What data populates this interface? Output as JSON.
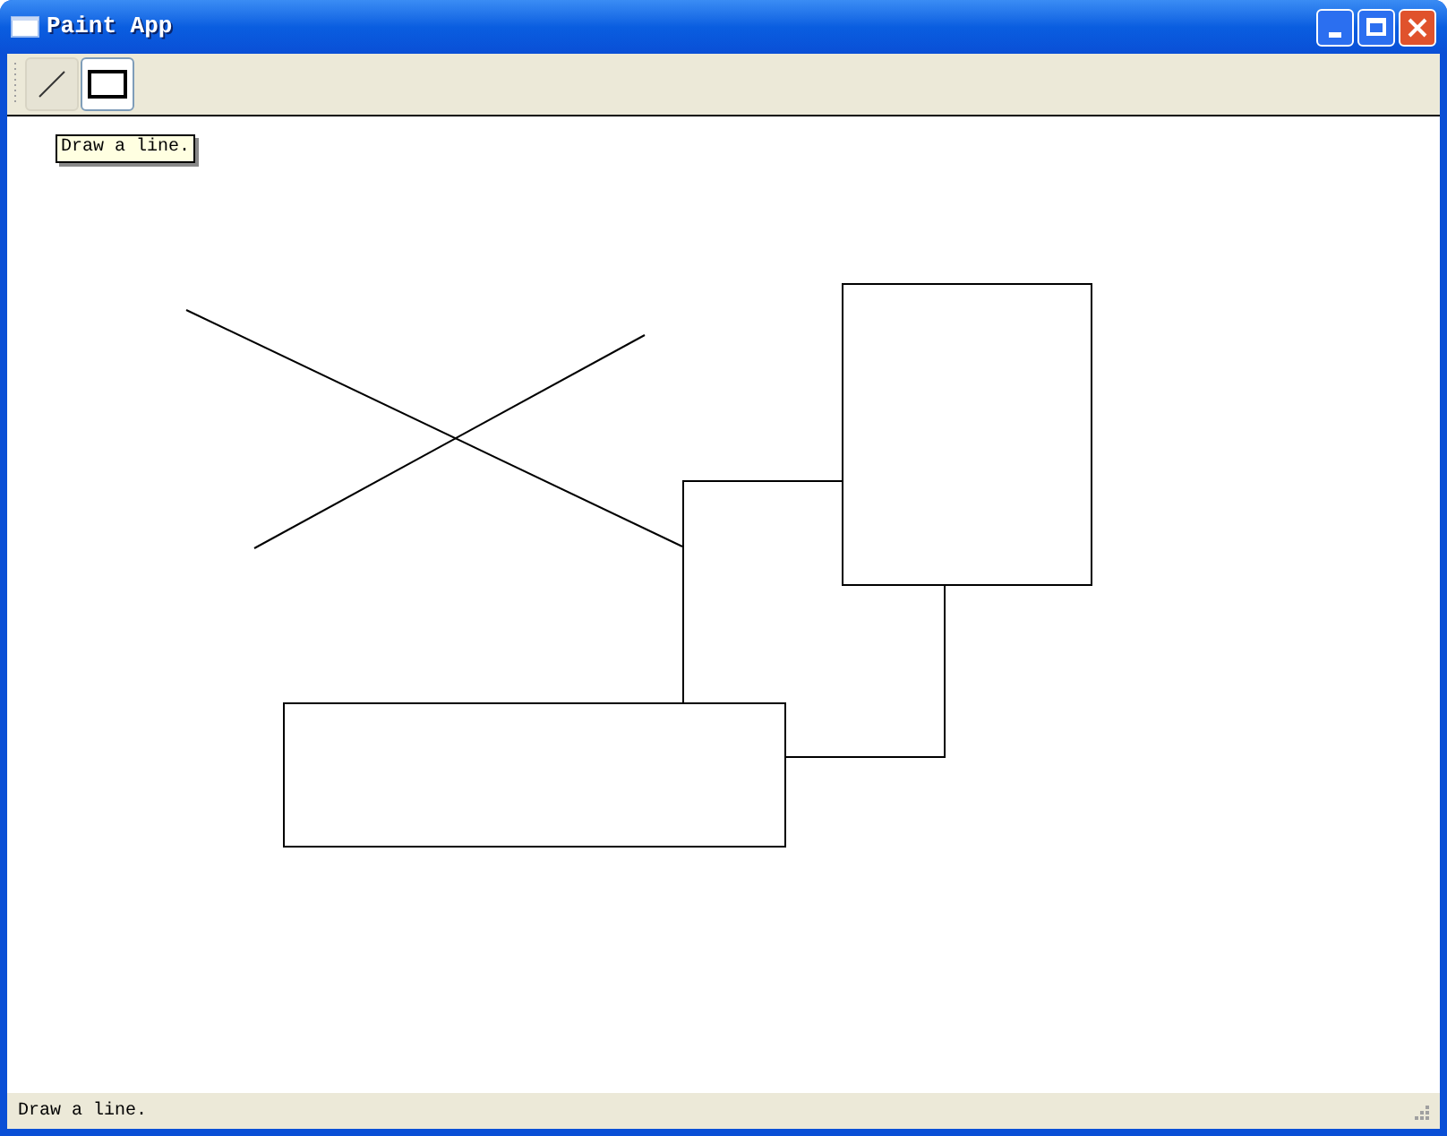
{
  "window": {
    "title": "Paint App"
  },
  "toolbar": {
    "tools": [
      {
        "kind": "line",
        "selected": false
      },
      {
        "kind": "rect",
        "selected": true
      }
    ]
  },
  "tooltip": "Draw a line.",
  "status_bar": "Draw a line."
}
